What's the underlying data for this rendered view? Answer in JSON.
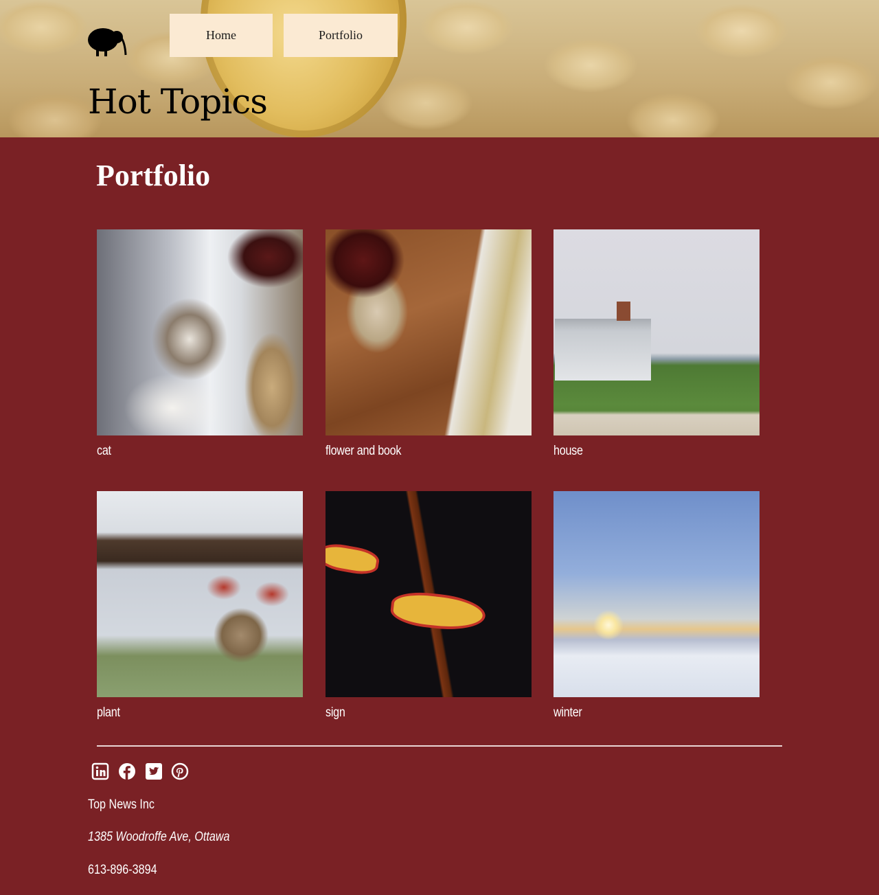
{
  "header": {
    "logo_icon": "kiwi-bird-icon",
    "nav": {
      "home_label": "Home",
      "portfolio_label": "Portfolio"
    },
    "site_title": "Hot Topics"
  },
  "main": {
    "heading": "Portfolio",
    "gallery": [
      {
        "caption": "cat"
      },
      {
        "caption": "flower and book"
      },
      {
        "caption": "house"
      },
      {
        "caption": "plant"
      },
      {
        "caption": "sign"
      },
      {
        "caption": "winter"
      }
    ]
  },
  "footer": {
    "social_icons": [
      "linkedin-icon",
      "facebook-icon",
      "twitter-icon",
      "pinterest-icon"
    ],
    "company": "Top News Inc",
    "address": "1385 Woodroffe Ave, Ottawa",
    "phone": "613-896-3894"
  },
  "colors": {
    "page_background": "#7a2125",
    "nav_button_background": "#fbead3",
    "text_light": "#ffffff"
  }
}
